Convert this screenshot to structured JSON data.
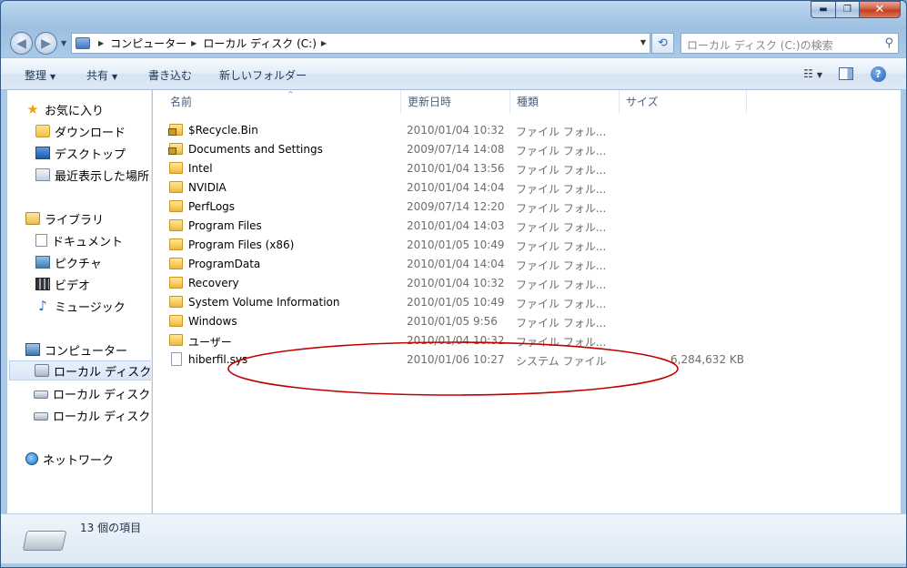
{
  "window": {
    "caption": {
      "minimize": "▬",
      "maximize": "❐",
      "close": "✕"
    }
  },
  "address": {
    "crumbs": [
      "コンピューター",
      "ローカル ディスク (C:)"
    ],
    "search_placeholder": "ローカル ディスク (C:)の検索"
  },
  "toolbar": {
    "organize": "整理",
    "share": "共有",
    "burn": "書き込む",
    "new_folder": "新しいフォルダー"
  },
  "navpane": {
    "favorites": "お気に入り",
    "downloads": "ダウンロード",
    "desktop": "デスクトップ",
    "recent": "最近表示した場所",
    "libraries": "ライブラリ",
    "documents": "ドキュメント",
    "pictures": "ピクチャ",
    "videos": "ビデオ",
    "music": "ミュージック",
    "computer": "コンピューター",
    "disk1": "ローカル ディスク (",
    "disk2": "ローカル ディスク (",
    "disk3": "ローカル ディスク (",
    "network": "ネットワーク"
  },
  "columns": {
    "name": "名前",
    "date": "更新日時",
    "type": "種類",
    "size": "サイズ"
  },
  "files": [
    {
      "name": "$Recycle.Bin",
      "date": "2010/01/04 10:32",
      "type": "ファイル フォル...",
      "size": ""
    },
    {
      "name": "Documents and Settings",
      "date": "2009/07/14 14:08",
      "type": "ファイル フォル...",
      "size": ""
    },
    {
      "name": "Intel",
      "date": "2010/01/04 13:56",
      "type": "ファイル フォル...",
      "size": ""
    },
    {
      "name": "NVIDIA",
      "date": "2010/01/04 14:04",
      "type": "ファイル フォル...",
      "size": ""
    },
    {
      "name": "PerfLogs",
      "date": "2009/07/14 12:20",
      "type": "ファイル フォル...",
      "size": ""
    },
    {
      "name": "Program Files",
      "date": "2010/01/04 14:03",
      "type": "ファイル フォル...",
      "size": ""
    },
    {
      "name": "Program Files (x86)",
      "date": "2010/01/05 10:49",
      "type": "ファイル フォル...",
      "size": ""
    },
    {
      "name": "ProgramData",
      "date": "2010/01/04 14:04",
      "type": "ファイル フォル...",
      "size": ""
    },
    {
      "name": "Recovery",
      "date": "2010/01/04 10:32",
      "type": "ファイル フォル...",
      "size": ""
    },
    {
      "name": "System Volume Information",
      "date": "2010/01/05 10:49",
      "type": "ファイル フォル...",
      "size": ""
    },
    {
      "name": "Windows",
      "date": "2010/01/05 9:56",
      "type": "ファイル フォル...",
      "size": ""
    },
    {
      "name": "ユーザー",
      "date": "2010/01/04 10:32",
      "type": "ファイル フォル...",
      "size": ""
    },
    {
      "name": "hiberfil.sys",
      "date": "2010/01/06 10:27",
      "type": "システム ファイル",
      "size": "6,284,632 KB"
    }
  ],
  "status": {
    "count": "13 個の項目"
  },
  "colors": {
    "annotation": "#c00000"
  }
}
